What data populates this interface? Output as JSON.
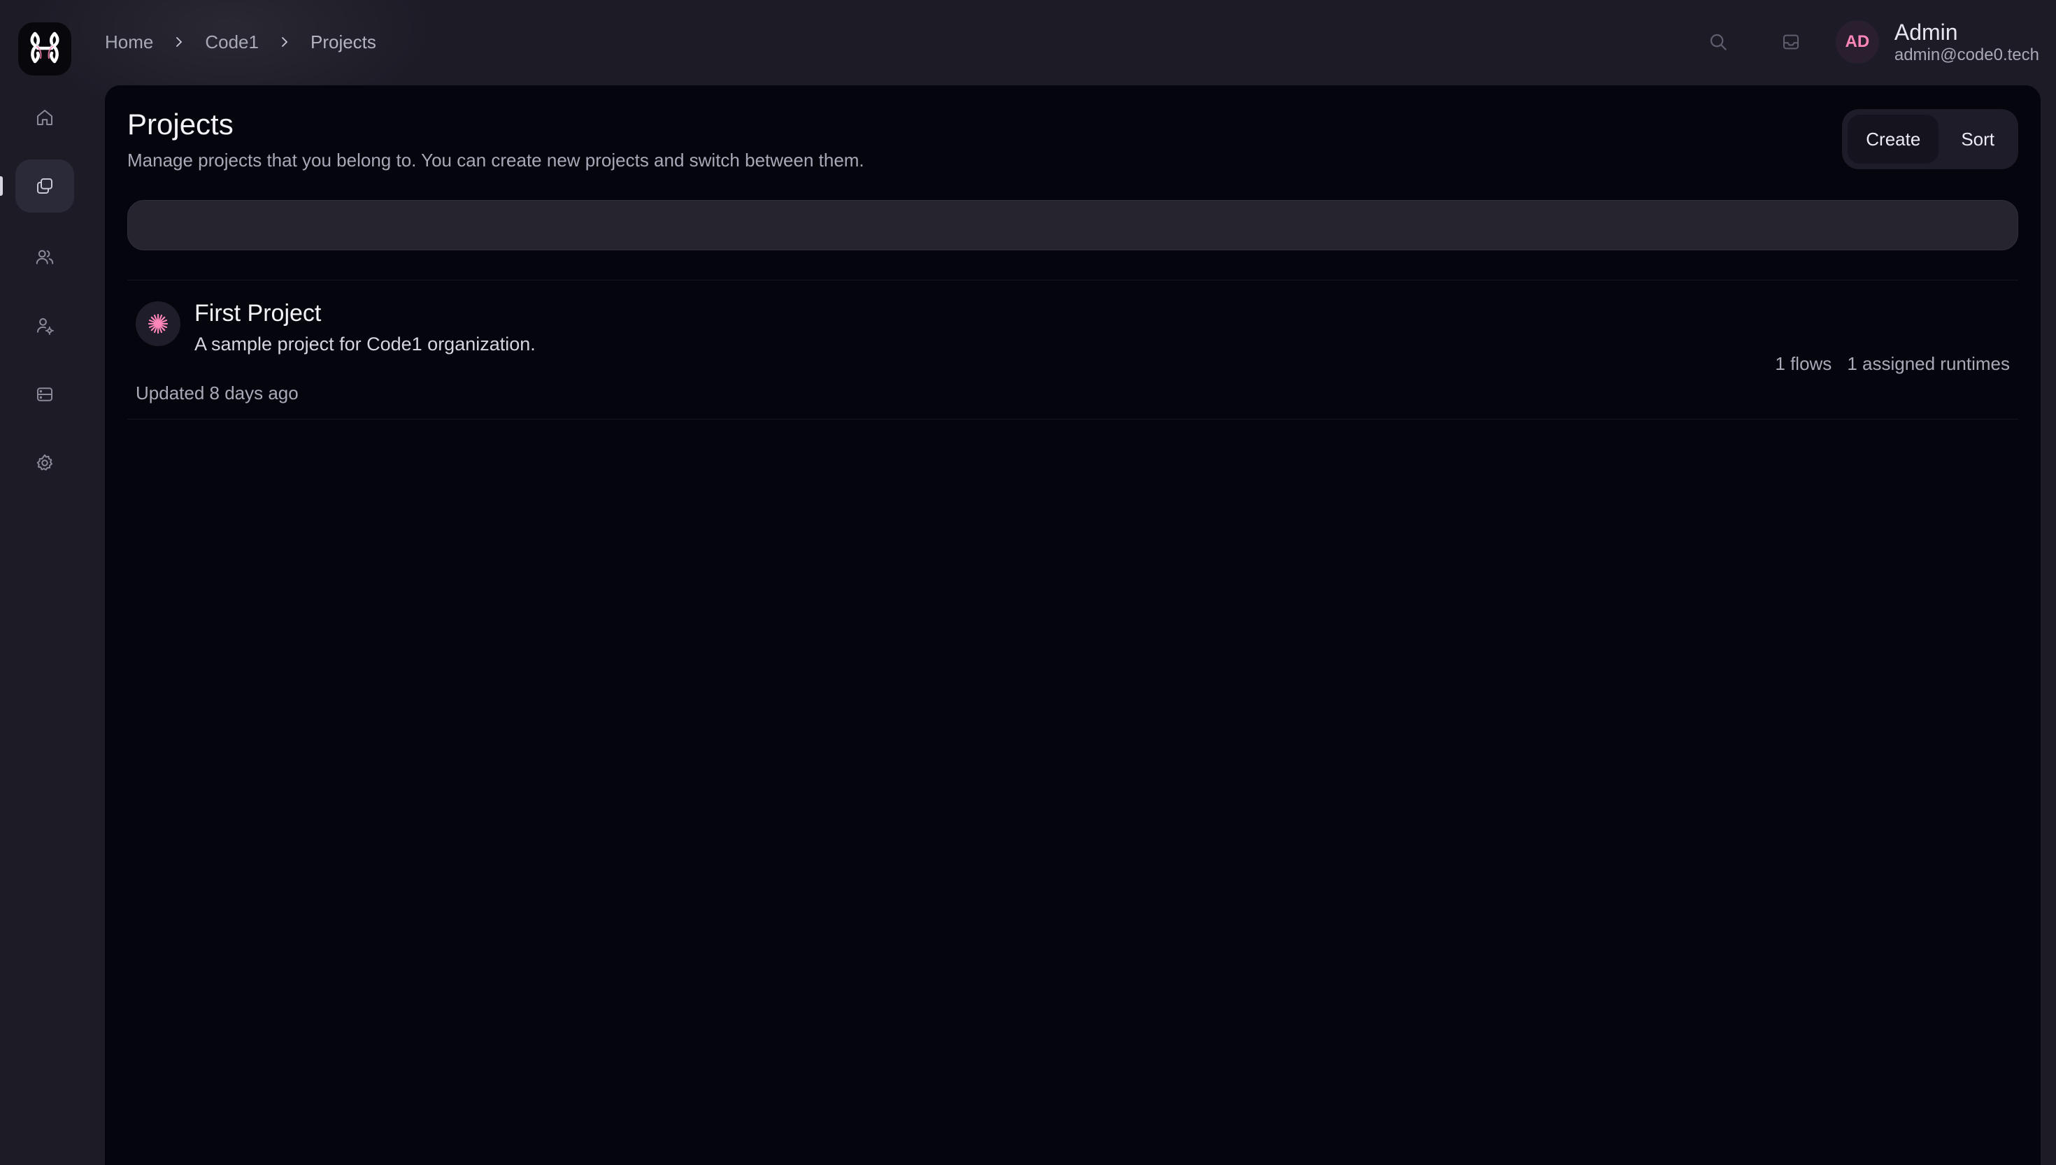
{
  "breadcrumb": {
    "items": [
      "Home",
      "Code1",
      "Projects"
    ]
  },
  "user": {
    "initials": "AD",
    "name": "Admin",
    "email": "admin@code0.tech"
  },
  "page": {
    "title": "Projects",
    "subtitle": "Manage projects that you belong to. You can create new projects and switch between them."
  },
  "actions": {
    "create_label": "Create",
    "sort_label": "Sort"
  },
  "search": {
    "value": "",
    "placeholder": ""
  },
  "projects": [
    {
      "name": "First Project",
      "description": "A sample project for Code1 organization.",
      "updated": "Updated 8 days ago",
      "flows": "1 flows",
      "runtimes": "1 assigned runtimes"
    }
  ],
  "colors": {
    "accent": "#ff86b6",
    "background": "#05050d",
    "sidebar": "#1c1b26"
  },
  "icons": {
    "sidebar": [
      "home-icon",
      "projects-icon",
      "users-icon",
      "user-settings-icon",
      "server-icon",
      "settings-icon"
    ],
    "topbar": [
      "search-icon",
      "inbox-icon"
    ],
    "project": "sparkle-icon"
  }
}
